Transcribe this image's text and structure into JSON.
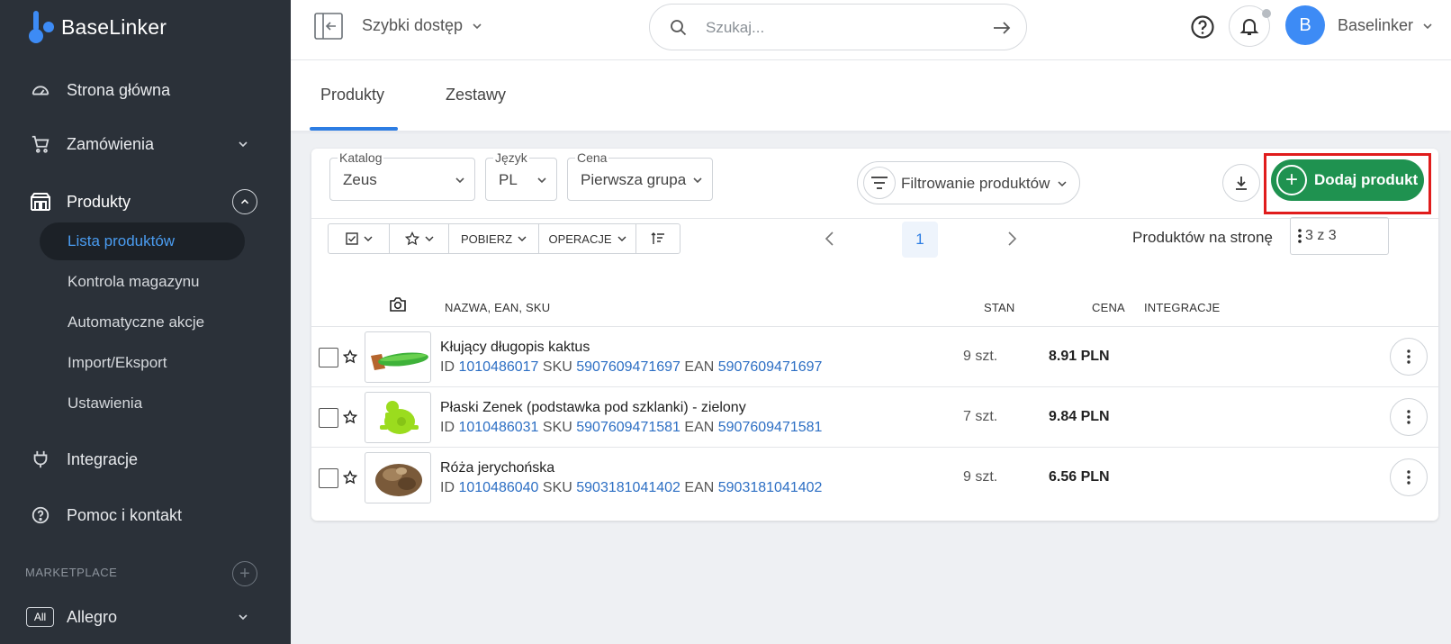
{
  "app": {
    "logo_text": "BaseLinker"
  },
  "sidebar": {
    "items": [
      {
        "label": "Strona główna",
        "icon": "gauge-icon"
      },
      {
        "label": "Zamówienia",
        "icon": "cart-icon"
      },
      {
        "label": "Produkty",
        "icon": "warehouse-icon"
      },
      {
        "label": "Integracje",
        "icon": "plug-icon"
      },
      {
        "label": "Pomoc i kontakt",
        "icon": "help-circle-icon"
      }
    ],
    "subitems": [
      {
        "label": "Lista produktów",
        "active": true
      },
      {
        "label": "Kontrola magazynu"
      },
      {
        "label": "Automatyczne akcje"
      },
      {
        "label": "Import/Eksport"
      },
      {
        "label": "Ustawienia"
      }
    ],
    "marketplace_label": "MARKETPLACE",
    "marketplace_item": {
      "badge": "All",
      "label": "Allegro"
    }
  },
  "topbar": {
    "quick_access": "Szybki dostęp",
    "search_placeholder": "Szukaj...",
    "avatar_letter": "B",
    "user_name": "Baselinker"
  },
  "tabs": [
    {
      "label": "Produkty",
      "active": true
    },
    {
      "label": "Zestawy"
    }
  ],
  "filters": {
    "catalog": {
      "caption": "Katalog",
      "value": "Zeus"
    },
    "language": {
      "caption": "Język",
      "value": "PL"
    },
    "price": {
      "caption": "Cena",
      "value": "Pierwsza grupa"
    },
    "filter_button": "Filtrowanie produktów",
    "add_button": "Dodaj produkt"
  },
  "toolbar": {
    "download_label": "POBIERZ",
    "operations_label": "OPERACJE"
  },
  "pagination": {
    "current_page": "1",
    "per_page_label": "Produktów na stronę",
    "per_page_value": "3 z 3"
  },
  "table": {
    "headers": {
      "name": "NAZWA, EAN, SKU",
      "stock": "STAN",
      "price": "CENA",
      "integrations": "INTEGRACJE"
    },
    "meta_labels": {
      "id": "ID",
      "sku": "SKU",
      "ean": "EAN"
    },
    "rows": [
      {
        "name": "Kłujący długopis kaktus",
        "id": "1010486017",
        "sku": "5907609471697",
        "ean": "5907609471697",
        "stock": "9 szt.",
        "price": "8.91 PLN"
      },
      {
        "name": "Płaski Zenek (podstawka pod szklanki) - zielony",
        "id": "1010486031",
        "sku": "5907609471581",
        "ean": "5907609471581",
        "stock": "7 szt.",
        "price": "9.84 PLN"
      },
      {
        "name": "Róża jerychońska",
        "id": "1010486040",
        "sku": "5903181041402",
        "ean": "5903181041402",
        "stock": "9 szt.",
        "price": "6.56 PLN"
      }
    ]
  },
  "colors": {
    "sidebar_bg": "#2b3139",
    "accent_blue": "#2d7de3",
    "add_green": "#1f9250",
    "highlight_red": "#e01c1c"
  }
}
